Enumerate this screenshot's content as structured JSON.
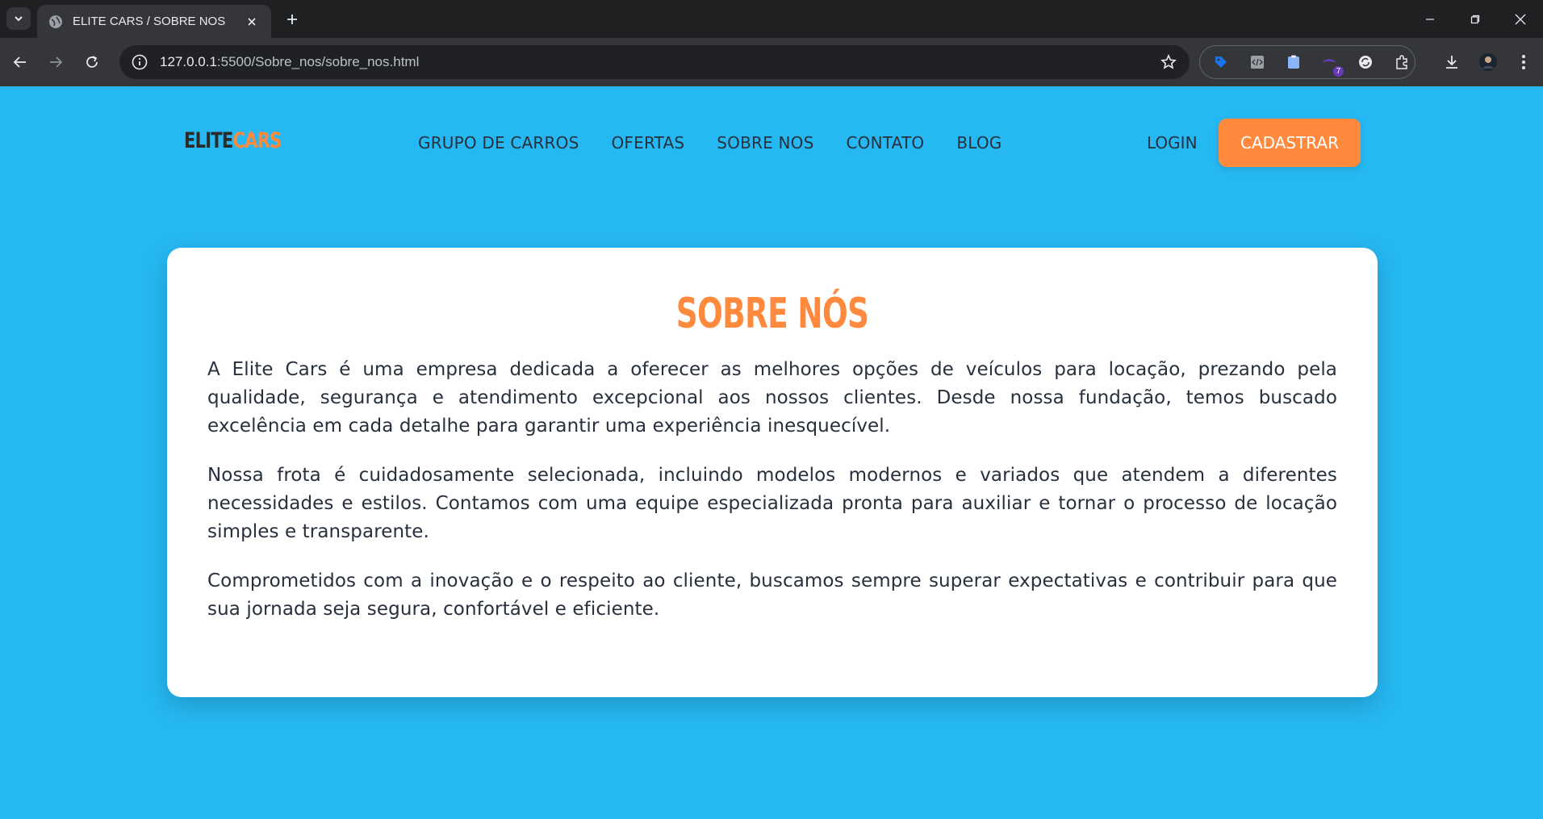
{
  "browser": {
    "tab_title": "ELITE CARS / SOBRE NOS",
    "url_host": "127.0.0.1",
    "url_path": ":5500/Sobre_nos/sobre_nos.html",
    "extension_badge": "7"
  },
  "header": {
    "logo_part1": "ELITE",
    "logo_part2": "CARS",
    "nav": [
      "GRUPO DE CARROS",
      "OFERTAS",
      "SOBRE NOS",
      "CONTATO",
      "BLOG"
    ],
    "login_label": "LOGIN",
    "signup_label": "CADASTRAR"
  },
  "about": {
    "title": "SOBRE NÓS",
    "paragraphs": [
      "A Elite Cars é uma empresa dedicada a oferecer as melhores opções de veículos para locação, prezando pela qualidade, segurança e atendimento excepcional aos nossos clientes. Desde nossa fundação, temos buscado excelência em cada detalhe para garantir uma experiência inesquecível.",
      "Nossa frota é cuidadosamente selecionada, incluindo modelos modernos e variados que atendem a diferentes necessidades e estilos. Contamos com uma equipe especializada pronta para auxiliar e tornar o processo de locação simples e transparente.",
      "Comprometidos com a inovação e o respeito ao cliente, buscamos sempre superar expectativas e contribuir para que sua jornada seja segura, confortável e eficiente."
    ]
  },
  "colors": {
    "page_background": "#26b8f2",
    "accent": "#ff8a3d",
    "text": "#27303d"
  }
}
